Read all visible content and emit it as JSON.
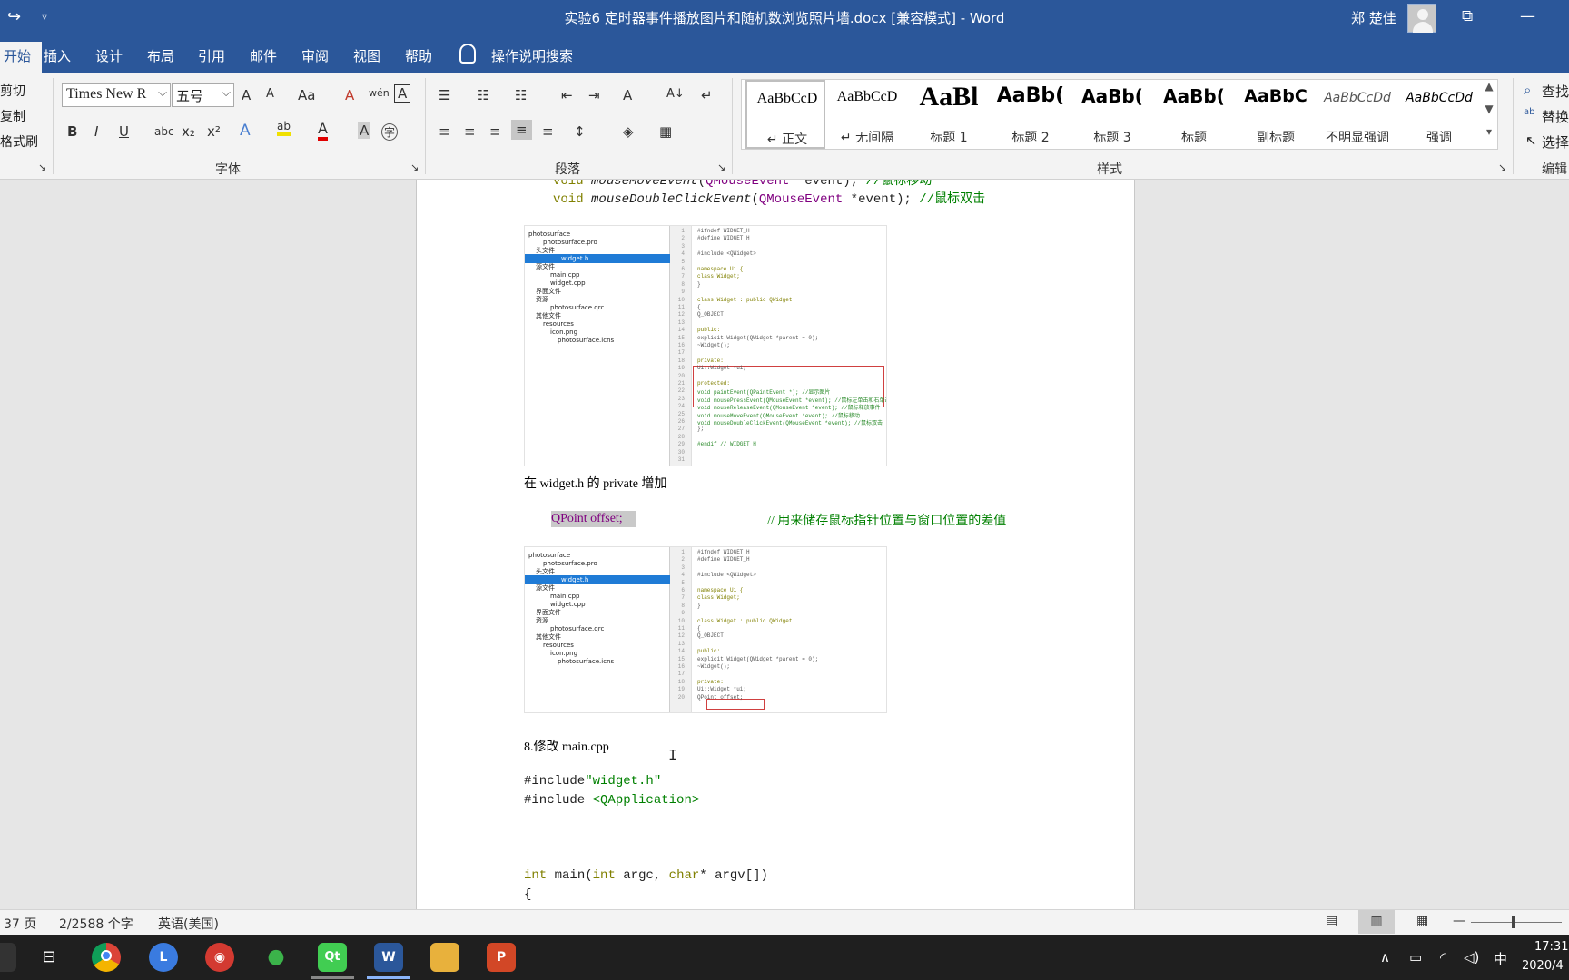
{
  "titlebar": {
    "title": "实验6 定时器事件播放图片和随机数浏览照片墙.docx [兼容模式]  -  Word",
    "user": "郑 楚佳",
    "redo_icon": "↪",
    "quick_access_icon": "▿",
    "restore_icon": "⧉",
    "minimize_icon": "—"
  },
  "tabs": {
    "home": "开始",
    "insert": "插入",
    "design": "设计",
    "layout": "布局",
    "references": "引用",
    "mailings": "邮件",
    "review": "审阅",
    "view": "视图",
    "help": "帮助",
    "tell_me": "操作说明搜索"
  },
  "ribbon": {
    "clipboard": {
      "cut": "剪切",
      "copy": "复制",
      "format_painter": "格式刷"
    },
    "font_group_label": "字体",
    "paragraph_group_label": "段落",
    "styles_group_label": "样式",
    "editing_group_label": "编辑",
    "font_name": "Times New R",
    "font_size": "五号",
    "grow_font": "A",
    "shrink_font": "A",
    "change_case": "Aa",
    "clear_format": "A",
    "phonetic": "wén",
    "char_border": "A",
    "bold": "B",
    "italic": "I",
    "underline": "U",
    "strike": "abc",
    "subscript": "x₂",
    "superscript": "x²",
    "text_effect": "A",
    "highlight": "ab",
    "font_color": "A",
    "char_shading": "A",
    "enclose_char": "字",
    "bullets": "☰",
    "numbering": "☷",
    "multilevel": "☷",
    "decrease_indent": "⇤",
    "increase_indent": "⇥",
    "chinese_layout": "A",
    "sort": "A↓",
    "show_marks": "↵",
    "align_left": "≡",
    "align_center": "≡",
    "align_right": "≡",
    "justify": "≡",
    "distributed": "≡",
    "line_spacing": "↕",
    "shading": "◈",
    "borders": "▦",
    "styles": [
      {
        "preview": "AaBbCcD",
        "name": "↵ 正文"
      },
      {
        "preview": "AaBbCcD",
        "name": "↵ 无间隔"
      },
      {
        "preview": "AaBl",
        "name": "标题 1"
      },
      {
        "preview": "AaBb(",
        "name": "标题 2"
      },
      {
        "preview": "AaBb(",
        "name": "标题 3"
      },
      {
        "preview": "AaBb(",
        "name": "标题"
      },
      {
        "preview": "AaBbC",
        "name": "副标题"
      },
      {
        "preview": "AaBbCcDd",
        "name": "不明显强调"
      },
      {
        "preview": "AaBbCcDd",
        "name": "强调"
      }
    ],
    "styles_up": "▲",
    "styles_down": "▼",
    "styles_more": "▾",
    "find": "查找",
    "replace": "替换",
    "select": "选择",
    "find_icon": "⌕",
    "replace_icon": "ab",
    "select_icon": "↖",
    "group_launcher": "↘"
  },
  "document": {
    "line_mousemove_kw": "void",
    "line_mousemove_fn": "mouseMoveEvent",
    "line_mousemove_cls": "QMouseEvent",
    "line_mousemove_rest": " *event);",
    "line_mousemove_cmt": " //鼠标移动",
    "line_dbl_kw": "void",
    "line_dbl_fn": "mouseDoubleClickEvent",
    "line_dbl_cls": "QMouseEvent",
    "line_dbl_rest": " *event);",
    "line_dbl_cmt": "  //鼠标双击",
    "para_private": "在 widget.h 的 private 增加",
    "offset_code": "QPoint offset;",
    "offset_comment": "// 用来储存鼠标指针位置与窗口位置的差值",
    "section8": "8.修改 main.cpp",
    "include1_pre": "#include",
    "include1_str": "\"widget.h\"",
    "include2_pre": "#include ",
    "include2_str": "<QApplication>",
    "main_kw": "int",
    "main_fn": " main",
    "main_paren": "(",
    "main_kw2": "int",
    "main_arg1": " argc, ",
    "main_kw3": "char",
    "main_arg2": "* argv[])",
    "brace": "{"
  },
  "screenshot1": {
    "tree": [
      "photosurface",
      "photosurface.pro",
      "头文件",
      "widget.h",
      "源文件",
      "main.cpp",
      "widget.cpp",
      "界面文件",
      "资源",
      "photosurface.qrc",
      "其他文件",
      "resources",
      "icon.png",
      "photosurface.icns"
    ],
    "lines": [
      "1",
      "2",
      "3",
      "4",
      "5",
      "6",
      "7",
      "8",
      "9",
      "10",
      "11",
      "12",
      "13",
      "14",
      "15",
      "16",
      "17",
      "18",
      "19",
      "20",
      "21",
      "22",
      "23",
      "24",
      "25",
      "26",
      "27",
      "28",
      "29",
      "30",
      "31"
    ],
    "code": [
      "#ifndef WIDGET_H",
      "#define WIDGET_H",
      "",
      "#include <QWidget>",
      "",
      "namespace Ui {",
      "class Widget;",
      "}",
      "",
      "class Widget : public QWidget",
      "{",
      "    Q_OBJECT",
      "",
      "public:",
      "    explicit Widget(QWidget *parent = 0);",
      "    ~Widget();",
      "",
      "private:",
      "    Ui::Widget *ui;",
      "",
      "protected:",
      "    void paintEvent(QPaintEvent *);        //显示图片",
      "    void mousePressEvent(QMouseEvent *event);  //鼠标左单击和右单击",
      "    void mouseReleaseEvent(QMouseEvent *event);  //鼠标释放事件",
      "    void mouseMoveEvent(QMouseEvent *event); //鼠标移动",
      "    void mouseDoubleClickEvent(QMouseEvent *event);   //鼠标双击",
      "};",
      "",
      "#endif // WIDGET_H"
    ]
  },
  "screenshot2": {
    "tree": [
      "photosurface",
      "photosurface.pro",
      "头文件",
      "widget.h",
      "源文件",
      "main.cpp",
      "widget.cpp",
      "界面文件",
      "资源",
      "photosurface.qrc",
      "其他文件",
      "resources",
      "icon.png",
      "photosurface.icns"
    ],
    "lines": [
      "1",
      "2",
      "3",
      "4",
      "5",
      "6",
      "7",
      "8",
      "9",
      "10",
      "11",
      "12",
      "13",
      "14",
      "15",
      "16",
      "17",
      "18",
      "19",
      "20"
    ],
    "code": [
      "#ifndef WIDGET_H",
      "#define WIDGET_H",
      "",
      "#include <QWidget>",
      "",
      "namespace Ui {",
      "class Widget;",
      "}",
      "",
      "class Widget : public QWidget",
      "{",
      "    Q_OBJECT",
      "",
      "public:",
      "    explicit Widget(QWidget *parent = 0);",
      "    ~Widget();",
      "",
      "private:",
      "    Ui::Widget *ui;",
      "    QPoint offset;"
    ]
  },
  "statusbar": {
    "page": "37 页",
    "words": "2/2588 个字",
    "language": "英语(美国)",
    "read_mode": "▤",
    "print_layout": "▥",
    "web_layout": "▦",
    "zoom_minus": "—"
  },
  "taskbar": {
    "task_view": "⊟",
    "chrome": "",
    "app_l": "L",
    "netease": "◉",
    "wechat": "●",
    "qt": "Qt",
    "word": "W",
    "folder": "",
    "ppt": "P",
    "tray_up": "∧",
    "battery": "▭",
    "wifi": "◜",
    "volume": "◁)",
    "ime": "中",
    "time": "17:31",
    "date": "2020/4"
  },
  "colors": {
    "word_blue": "#2b579a",
    "ribbon_bg": "#f3f3f3",
    "code_purple": "#800080",
    "code_olive": "#808000",
    "comment_green": "#008000",
    "highlight_box": "#d04040"
  }
}
